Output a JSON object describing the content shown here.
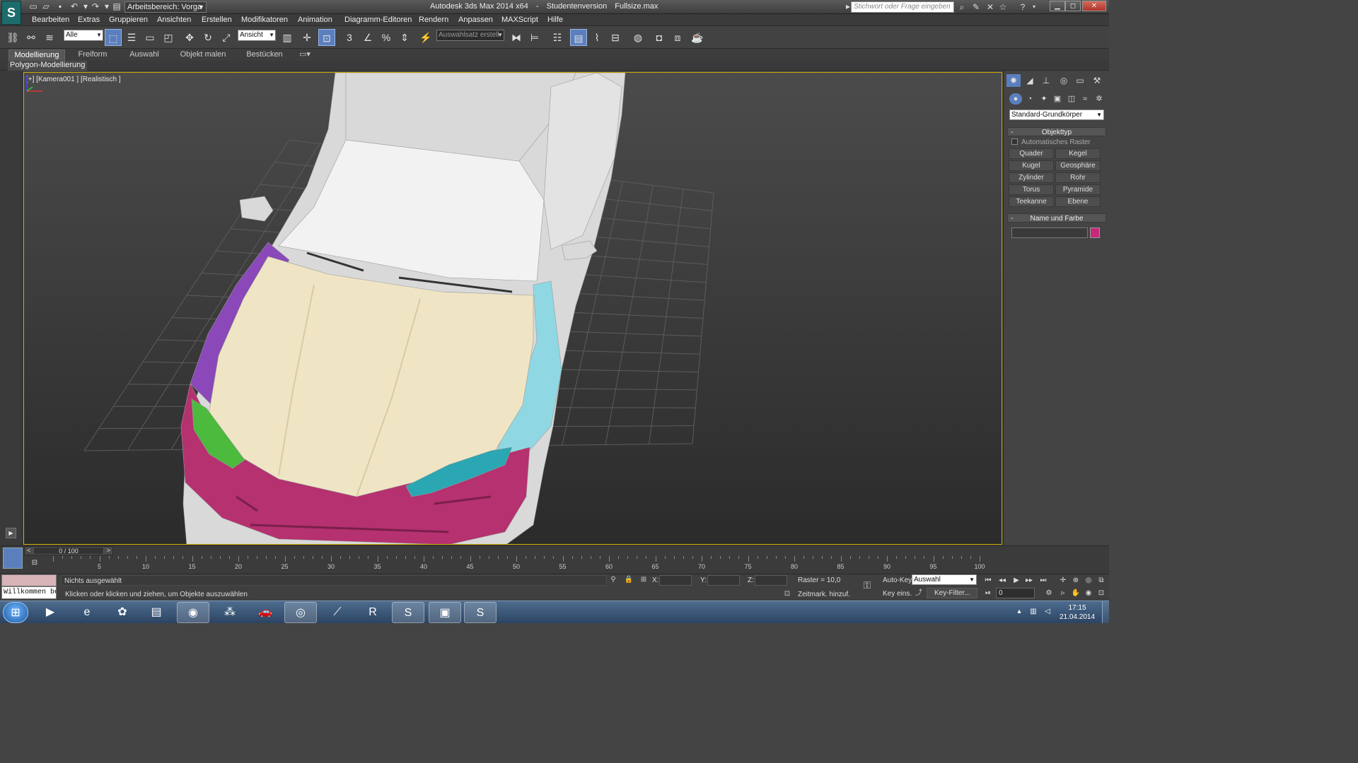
{
  "titlebar": {
    "workspace": "Arbeitsbereich: Vorga",
    "app_title": "Autodesk 3ds Max  2014 x64",
    "edition": "Studentenversion",
    "filename": "Fullsize.max",
    "help_search_placeholder": "Stichwort oder Frage eingeben",
    "help_label": "?"
  },
  "menu": [
    "Bearbeiten",
    "Extras",
    "Gruppieren",
    "Ansichten",
    "Erstellen",
    "Modifikatoren",
    "Animation",
    "Diagramm-Editoren",
    "Rendern",
    "Anpassen",
    "MAXScript",
    "Hilfe"
  ],
  "toolbar": {
    "filter_value": "Alle",
    "coord_system": "Ansicht",
    "named_selection_placeholder": "Auswahlsatz erstell",
    "snap_label": "3",
    "percent_label": "%"
  },
  "ribbon": {
    "tabs": [
      "Modellierung",
      "Freiform",
      "Auswahl",
      "Objekt malen",
      "Bestücken"
    ],
    "active_tab": 0,
    "panel_label": "Polygon-Modellierung"
  },
  "viewport": {
    "label": "[+] [Kamera001 ] [Realistisch ]",
    "border_color": "#c9a800",
    "object_colors": {
      "body": "#d9d9d9",
      "hood": "#efe5c5",
      "bumper": "#b5316f",
      "left_fender": "#8a48b8",
      "right_fender": "#8fd8e3",
      "left_headlight": "#4cba3c",
      "right_headlight": "#2aa7b3"
    }
  },
  "command_panel": {
    "category_dropdown": "Standard-Grundkörper",
    "objekttyp": {
      "title": "Objekttyp",
      "auto_grid": "Automatisches Raster",
      "buttons": [
        "Quader",
        "Kegel",
        "Kugel",
        "Geosphäre",
        "Zylinder",
        "Rohr",
        "Torus",
        "Pyramide",
        "Teekanne",
        "Ebene"
      ]
    },
    "name_und_farbe": {
      "title": "Name und Farbe",
      "name_value": "",
      "color": "#c8287a"
    },
    "collapse_sign": "-"
  },
  "timeline": {
    "frame_display": "0 / 100",
    "prev": "<",
    "next": ">",
    "ticks": [
      0,
      5,
      10,
      15,
      20,
      25,
      30,
      35,
      40,
      45,
      50,
      55,
      60,
      65,
      70,
      75,
      80,
      85,
      90,
      95,
      100
    ],
    "labels": [
      "5",
      "10",
      "15",
      "20",
      "25",
      "30",
      "35",
      "40",
      "45",
      "50",
      "55",
      "60",
      "65",
      "70",
      "75",
      "80",
      "85",
      "90",
      "95",
      "100"
    ]
  },
  "status": {
    "maxscript_input": "",
    "welcome": "Willkommen bei",
    "selection_status": "Nichts ausgewählt",
    "prompt": "Klicken oder klicken und ziehen, um Objekte auszuwählen",
    "x_label": "X:",
    "y_label": "Y:",
    "z_label": "Z:",
    "x_value": "",
    "y_value": "",
    "z_value": "",
    "grid": "Raster = 10,0",
    "add_time_tag": "Zeitmark. hinzuf.",
    "auto_key": "Auto-Key",
    "auto_key_mode": "Auswahl",
    "set_key": "Key eins.",
    "key_filter": "Key-Filter...",
    "current_frame": "0"
  },
  "taskbar": {
    "time": "17:15",
    "date": "21.04.2014"
  }
}
